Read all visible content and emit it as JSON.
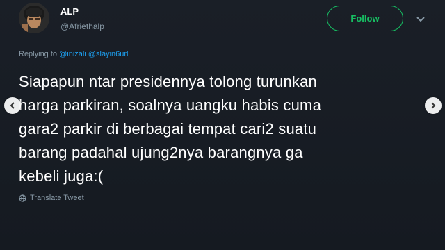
{
  "author": {
    "display_name": "ALP",
    "handle": "@Afriethalp"
  },
  "follow_button": {
    "label": "Follow"
  },
  "reply": {
    "prefix": "Replying to",
    "mentions": [
      "@inizali",
      "@slayin6url"
    ]
  },
  "tweet": {
    "lines": [
      "Siapapun ntar presidennya tolong turunkan",
      "harga parkiran, soalnya uangku habis cuma",
      "gara2 parkir di berbagai tempat cari2 suatu",
      "barang padahal ujung2nya barangnya ga",
      "kebeli juga:("
    ]
  },
  "translate": {
    "label": "Translate Tweet",
    "icon": "globe-icon"
  },
  "icons": {
    "caret": "chevron-down-icon",
    "nav_left": "chevron-left-icon",
    "nav_right": "chevron-right-icon"
  },
  "colors": {
    "background": "#161b22",
    "follow_green": "#17bf63",
    "mention_blue": "#1da1f2",
    "secondary_text": "#8899a6"
  }
}
